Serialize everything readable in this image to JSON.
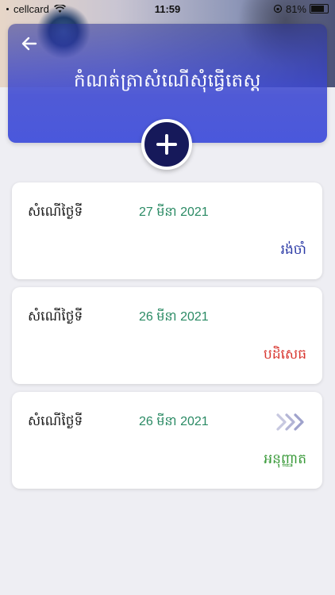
{
  "status_bar": {
    "carrier": "cellcard",
    "time": "11:59",
    "battery": "81%"
  },
  "header": {
    "back_icon": "arrow-left-icon",
    "title": "កំណត់ត្រាសំណើសុំធ្វើតេស្ត",
    "add_icon": "plus-icon"
  },
  "requests": [
    {
      "label": "សំណើថ្ងៃទី",
      "date": "27 មីនា 2021",
      "status": "រង់ចាំ",
      "status_color": "#2b3aa6",
      "show_arrows": false
    },
    {
      "label": "សំណើថ្ងៃទី",
      "date": "26 មីនា 2021",
      "status": "បដិសេធ",
      "status_color": "#d8352e",
      "show_arrows": false
    },
    {
      "label": "សំណើថ្ងៃទី",
      "date": "26 មីនា 2021",
      "status": "អនុញ្ញាត",
      "status_color": "#3a9a3a",
      "show_arrows": true
    }
  ],
  "colors": {
    "date_green": "#2a8a64",
    "header_blue": "#4a58dc",
    "add_button": "#16195a"
  }
}
